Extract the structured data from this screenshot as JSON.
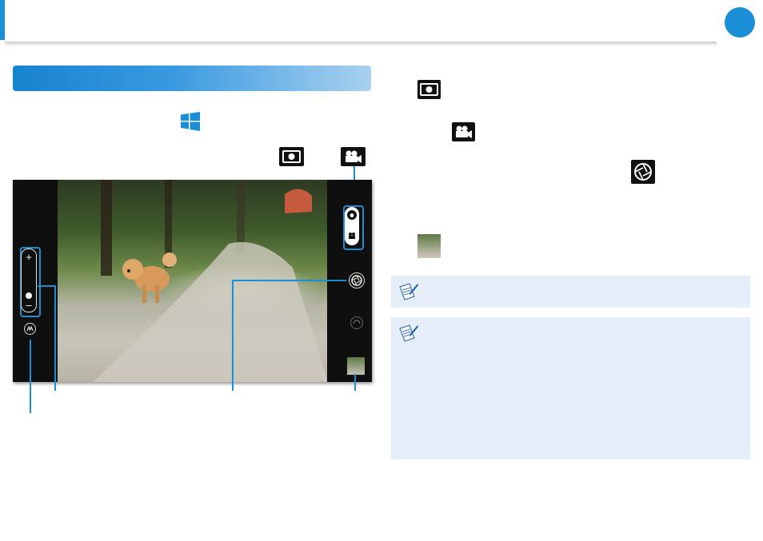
{
  "colors": {
    "accent": "#1b8fd6",
    "note_background": "#e6eff9"
  },
  "icons": {
    "windows_start": "windows-logo-icon",
    "camera_mode": "camera-icon",
    "video_mode": "video-camera-icon",
    "shutter": "shutter-icon",
    "thumbnail": "photo-thumbnail-icon",
    "note": "note-pen-icon",
    "effects": "effects-icon",
    "timer": "timer-icon"
  },
  "screenshot": {
    "zoom": {
      "plus": "+",
      "minus": "–"
    }
  }
}
